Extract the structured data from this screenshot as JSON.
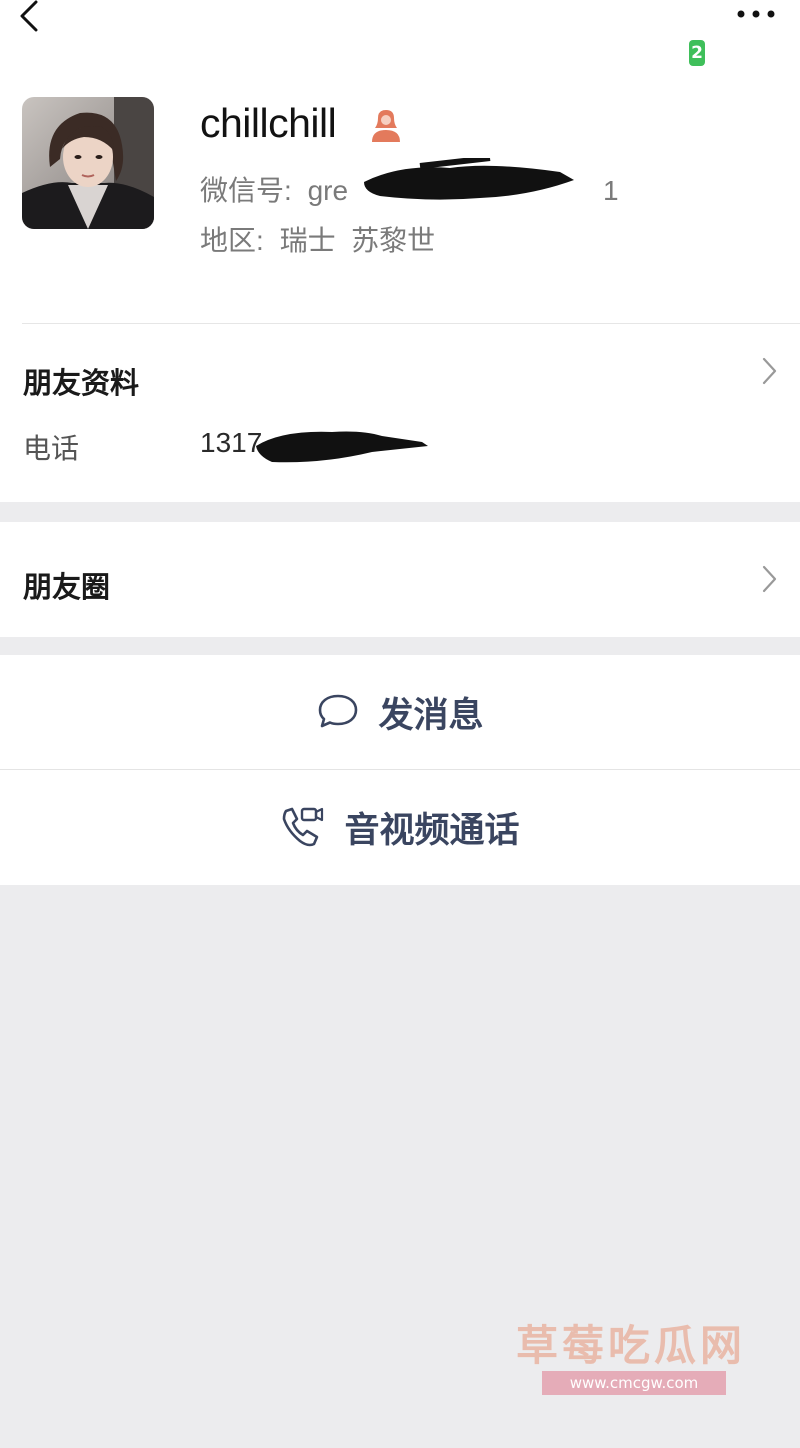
{
  "header": {
    "back_icon": "chevron-left-icon",
    "more_icon": "ellipsis-icon",
    "badge_text": "2"
  },
  "profile": {
    "nickname": "chillchill",
    "gender_icon": "female-user-icon",
    "wechat_id_label": "微信号:",
    "wechat_id_visible_start": "gre",
    "wechat_id_visible_end": "1",
    "region_label": "地区:",
    "region_value": "瑞士  苏黎世"
  },
  "friend_info": {
    "title": "朋友资料",
    "phone_label": "电话",
    "phone_value_visible": "1317"
  },
  "moments": {
    "title": "朋友圈"
  },
  "actions": {
    "message_label": "发消息",
    "call_label": "音视频通话"
  },
  "watermark": {
    "title": "草莓吃瓜网",
    "url": "www.cmcgw.com"
  },
  "colors": {
    "page_bg": "#ececee",
    "card_bg": "#ffffff",
    "action_text": "#3a4560",
    "badge_green": "#3fbf5a",
    "gender_icon": "#e37a5c"
  }
}
